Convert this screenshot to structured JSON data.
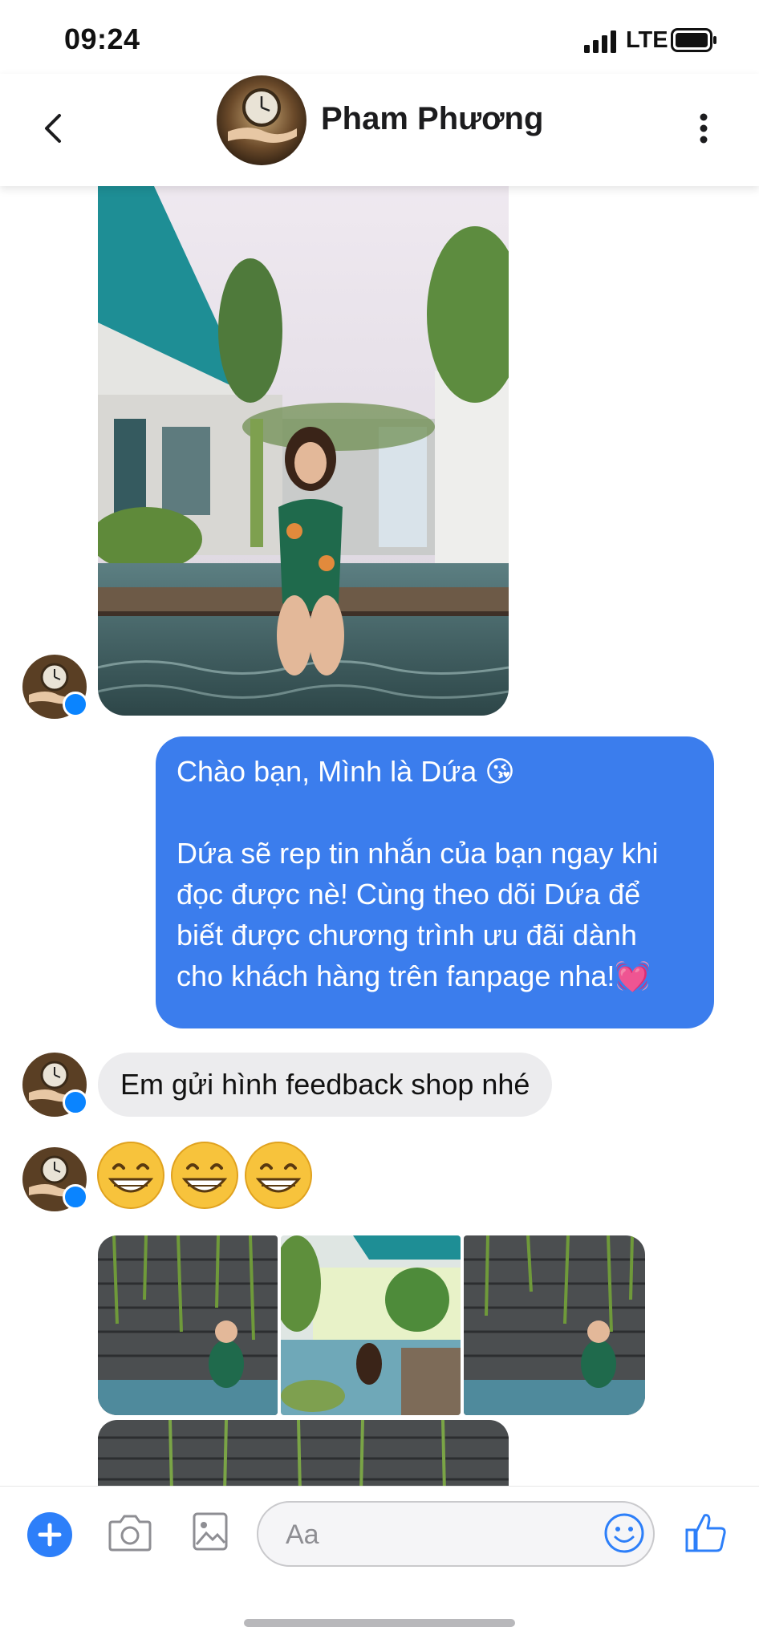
{
  "status_bar": {
    "time": "09:24",
    "network": "LTE"
  },
  "header": {
    "contact_name": "Pham Phương"
  },
  "messages": {
    "outgoing": {
      "line1": "Chào bạn, Mình là Dứa 😘",
      "line2": "Dứa sẽ rep tin nhắn của bạn ngay khi",
      "line3": "đọc được nè! Cùng theo dõi Dứa để",
      "line4": "biết được chương trình ưu đãi dành",
      "line5": "cho khách hàng trên fanpage nha!💓"
    },
    "incoming_text": "Em gửi hình feedback shop nhé",
    "incoming_emojis": [
      "grinning-face",
      "grinning-face",
      "grinning-face"
    ]
  },
  "composer": {
    "placeholder": "Aa"
  },
  "colors": {
    "outgoing_bubble": "#3b7ded",
    "incoming_bubble": "#ececee",
    "accent": "#2d7ff9"
  }
}
